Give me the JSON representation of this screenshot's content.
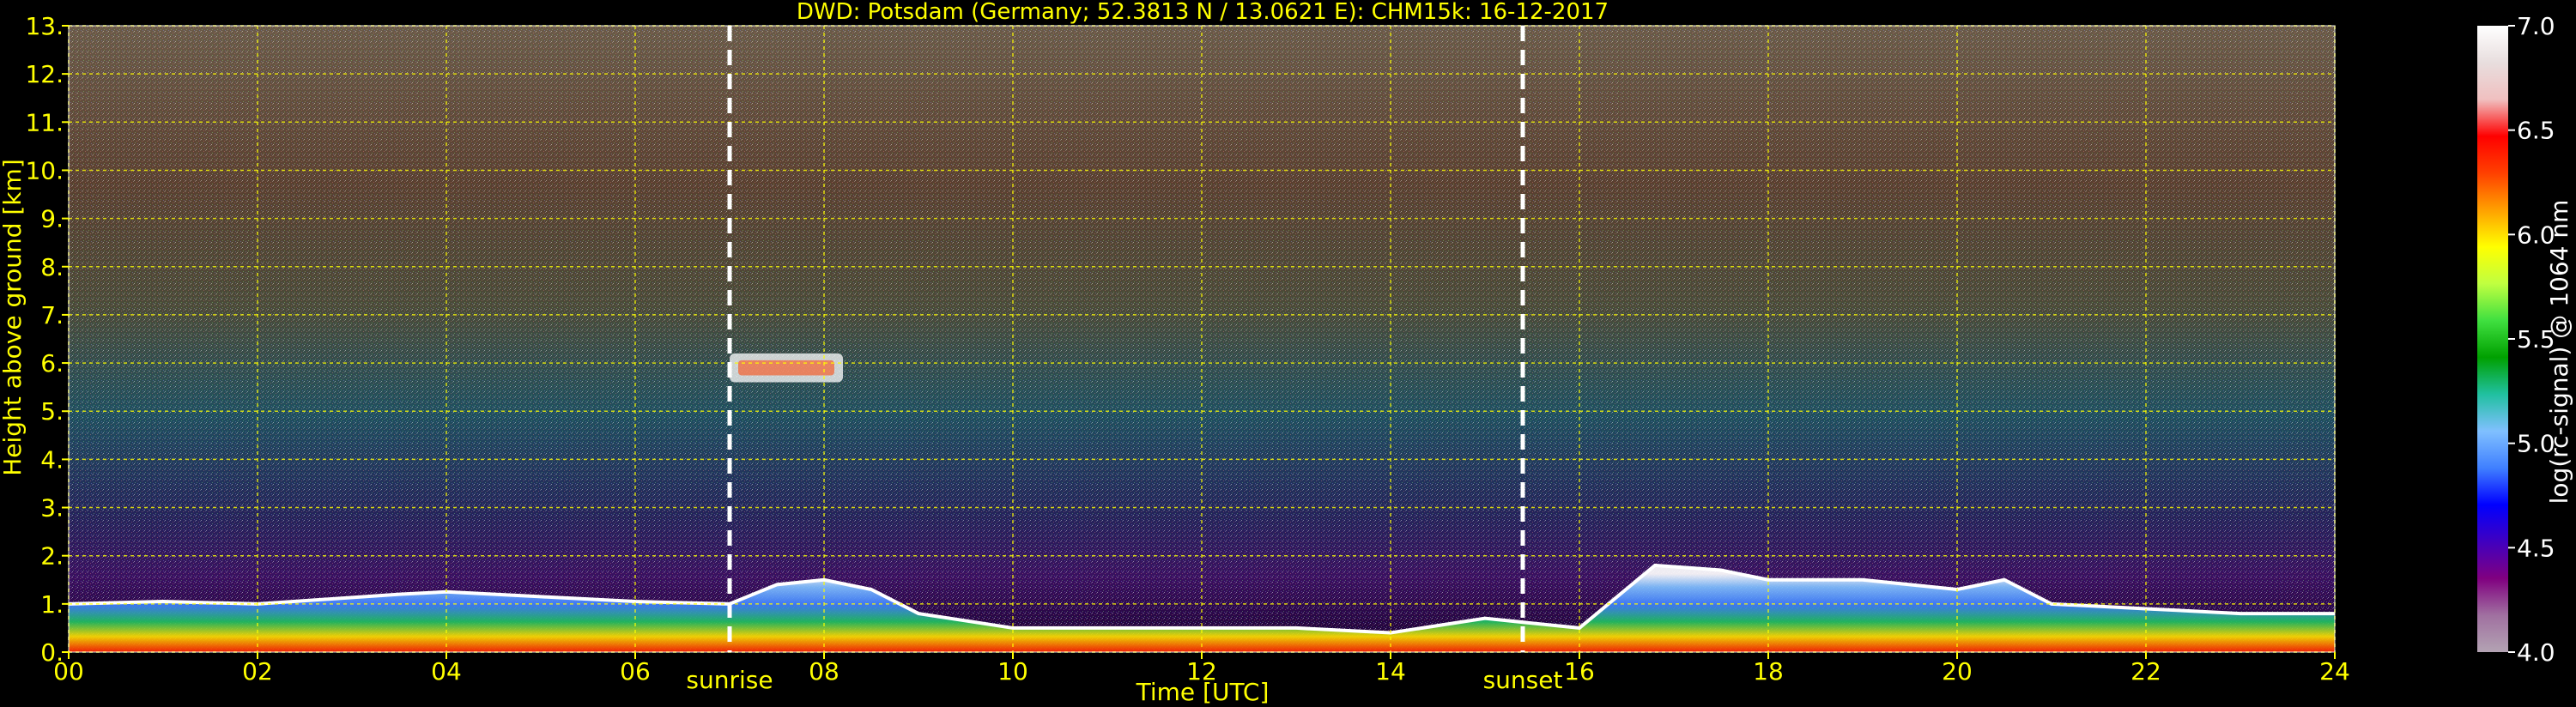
{
  "chart_data": {
    "type": "heatmap",
    "title": "DWD: Potsdam (Germany; 52.3813 N / 13.0621 E):    CHM15k: 16-12-2017",
    "xlabel": "Time [UTC]",
    "ylabel": "Height above ground [km]",
    "xlim": [
      0,
      24
    ],
    "ylim": [
      0,
      13
    ],
    "x_ticks": [
      "00",
      "02",
      "04",
      "06",
      "08",
      "10",
      "12",
      "14",
      "16",
      "18",
      "20",
      "22",
      "24"
    ],
    "y_ticks": [
      "0.",
      "1.",
      "2.",
      "3.",
      "4.",
      "5.",
      "6.",
      "7.",
      "8.",
      "9.",
      "10.",
      "11.",
      "12.",
      "13."
    ],
    "grid": true,
    "markers": [
      {
        "label": "sunrise",
        "x": 7.0
      },
      {
        "label": "sunset",
        "x": 15.4
      }
    ],
    "colorbar": {
      "label": "log(rc-signal) @ 1064 nm",
      "range": [
        4.0,
        7.0
      ],
      "ticks": [
        "4.0",
        "4.5",
        "5.0",
        "5.5",
        "6.0",
        "6.5",
        "7.0"
      ]
    },
    "boundary_layer_top_km": [
      {
        "x": 0,
        "y": 1.0
      },
      {
        "x": 1,
        "y": 1.05
      },
      {
        "x": 2,
        "y": 1.0
      },
      {
        "x": 3.5,
        "y": 1.2
      },
      {
        "x": 4,
        "y": 1.25
      },
      {
        "x": 5,
        "y": 1.15
      },
      {
        "x": 6,
        "y": 1.05
      },
      {
        "x": 7,
        "y": 1.0
      },
      {
        "x": 7.5,
        "y": 1.4
      },
      {
        "x": 8,
        "y": 1.5
      },
      {
        "x": 8.5,
        "y": 1.3
      },
      {
        "x": 9,
        "y": 0.8
      },
      {
        "x": 10,
        "y": 0.5
      },
      {
        "x": 11,
        "y": 0.5
      },
      {
        "x": 12,
        "y": 0.5
      },
      {
        "x": 13,
        "y": 0.5
      },
      {
        "x": 14,
        "y": 0.4
      },
      {
        "x": 15,
        "y": 0.7
      },
      {
        "x": 16,
        "y": 0.5
      },
      {
        "x": 16.8,
        "y": 1.8
      },
      {
        "x": 17.5,
        "y": 1.7
      },
      {
        "x": 18,
        "y": 1.5
      },
      {
        "x": 19,
        "y": 1.5
      },
      {
        "x": 20,
        "y": 1.3
      },
      {
        "x": 20.5,
        "y": 1.5
      },
      {
        "x": 21,
        "y": 1.0
      },
      {
        "x": 22,
        "y": 0.9
      },
      {
        "x": 23,
        "y": 0.8
      },
      {
        "x": 24,
        "y": 0.8
      }
    ],
    "cloud_features_km": [
      {
        "x_start": 7.0,
        "x_end": 8.2,
        "y_bottom": 5.6,
        "y_top": 6.2
      }
    ]
  },
  "colors": {
    "text": "#ffff00",
    "grid": "#ffff00",
    "marker": "#ffffff",
    "colorbar_stops": [
      "#b3a3b3",
      "#a070a0",
      "#800080",
      "#4000c0",
      "#0000ff",
      "#4080ff",
      "#80c0ff",
      "#20c0a0",
      "#00a000",
      "#40e040",
      "#c0ff40",
      "#ffff00",
      "#ffa000",
      "#ff4000",
      "#ff0000",
      "#f0c0c0",
      "#e8dede",
      "#ffffff"
    ]
  }
}
